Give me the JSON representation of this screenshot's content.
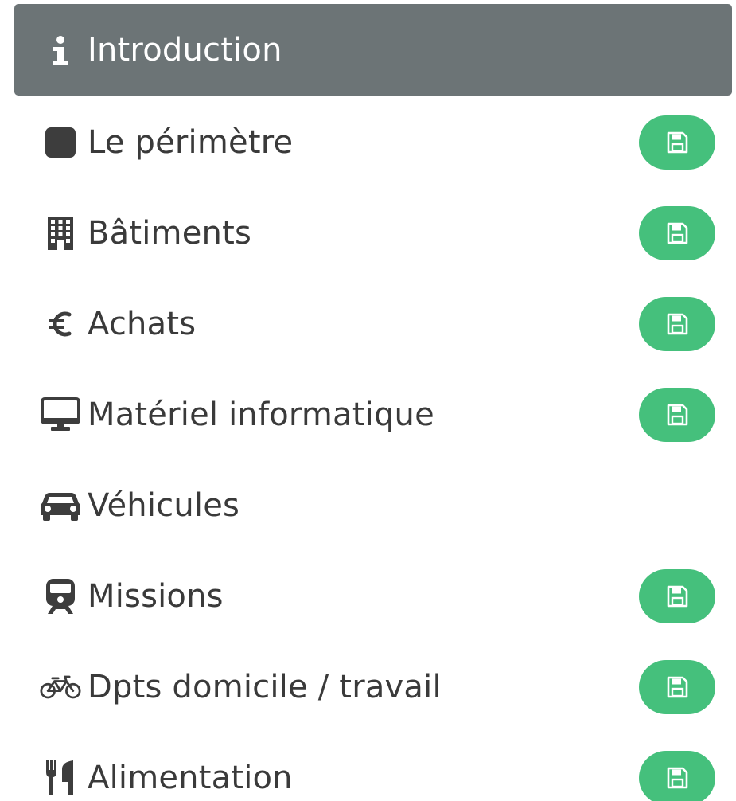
{
  "colors": {
    "active_bg": "#6c7476",
    "active_text": "#ffffff",
    "text": "#3a3a3a",
    "icon": "#3d3d3d",
    "save_button": "#45c07c",
    "save_icon": "#ffffff"
  },
  "nav": {
    "items": [
      {
        "label": "Introduction",
        "icon": "info-icon",
        "active": true,
        "has_save": false
      },
      {
        "label": "Le périmètre",
        "icon": "square-icon",
        "active": false,
        "has_save": true
      },
      {
        "label": "Bâtiments",
        "icon": "building-icon",
        "active": false,
        "has_save": true
      },
      {
        "label": "Achats",
        "icon": "euro-icon",
        "active": false,
        "has_save": true
      },
      {
        "label": "Matériel informatique",
        "icon": "desktop-icon",
        "active": false,
        "has_save": true
      },
      {
        "label": "Véhicules",
        "icon": "car-icon",
        "active": false,
        "has_save": false
      },
      {
        "label": "Missions",
        "icon": "train-icon",
        "active": false,
        "has_save": true
      },
      {
        "label": "Dpts domicile / travail",
        "icon": "bicycle-icon",
        "active": false,
        "has_save": true
      },
      {
        "label": "Alimentation",
        "icon": "cutlery-icon",
        "active": false,
        "has_save": true
      }
    ],
    "save_icon": "floppy-disk-icon"
  }
}
